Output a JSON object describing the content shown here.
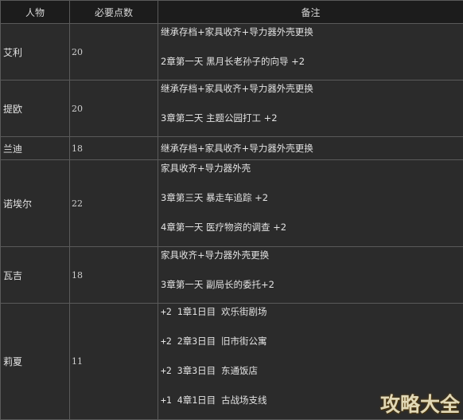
{
  "table": {
    "headers": [
      "人物",
      "必要点数",
      "备注"
    ],
    "rows": [
      {
        "name": "艾利",
        "points": "20",
        "notes": [
          "继承存档+家具收齐+导力器外壳更换",
          "2章第一天 黑月长老孙子的向导 +2"
        ]
      },
      {
        "name": "提欧",
        "points": "20",
        "notes": [
          "继承存档+家具收齐+导力器外壳更换",
          "3章第二天 主题公园打工 +2"
        ]
      },
      {
        "name": "兰迪",
        "points": "18",
        "notes": [
          "继承存档+家具收齐+导力器外壳更换"
        ]
      },
      {
        "name": "诺埃尔",
        "points": "22",
        "notes": [
          "家具收齐+导力器外壳",
          "3章第三天 暴走车追踪 +2",
          "4章第一天 医疗物资的调查 +2"
        ]
      },
      {
        "name": "瓦吉",
        "points": "18",
        "notes": [
          "家具收齐+导力器外壳更换",
          "3章第一天 副局长的委托+2"
        ]
      },
      {
        "name": "莉夏",
        "points": "11",
        "notes": [
          "+2 1章1日目  欢乐街剧场",
          "+2 2章3日目  旧市街公寓",
          "+2 3章3日目  东通饭店",
          "+1 4章1日目  古战场支线"
        ]
      }
    ]
  },
  "watermark": "攻略大全"
}
